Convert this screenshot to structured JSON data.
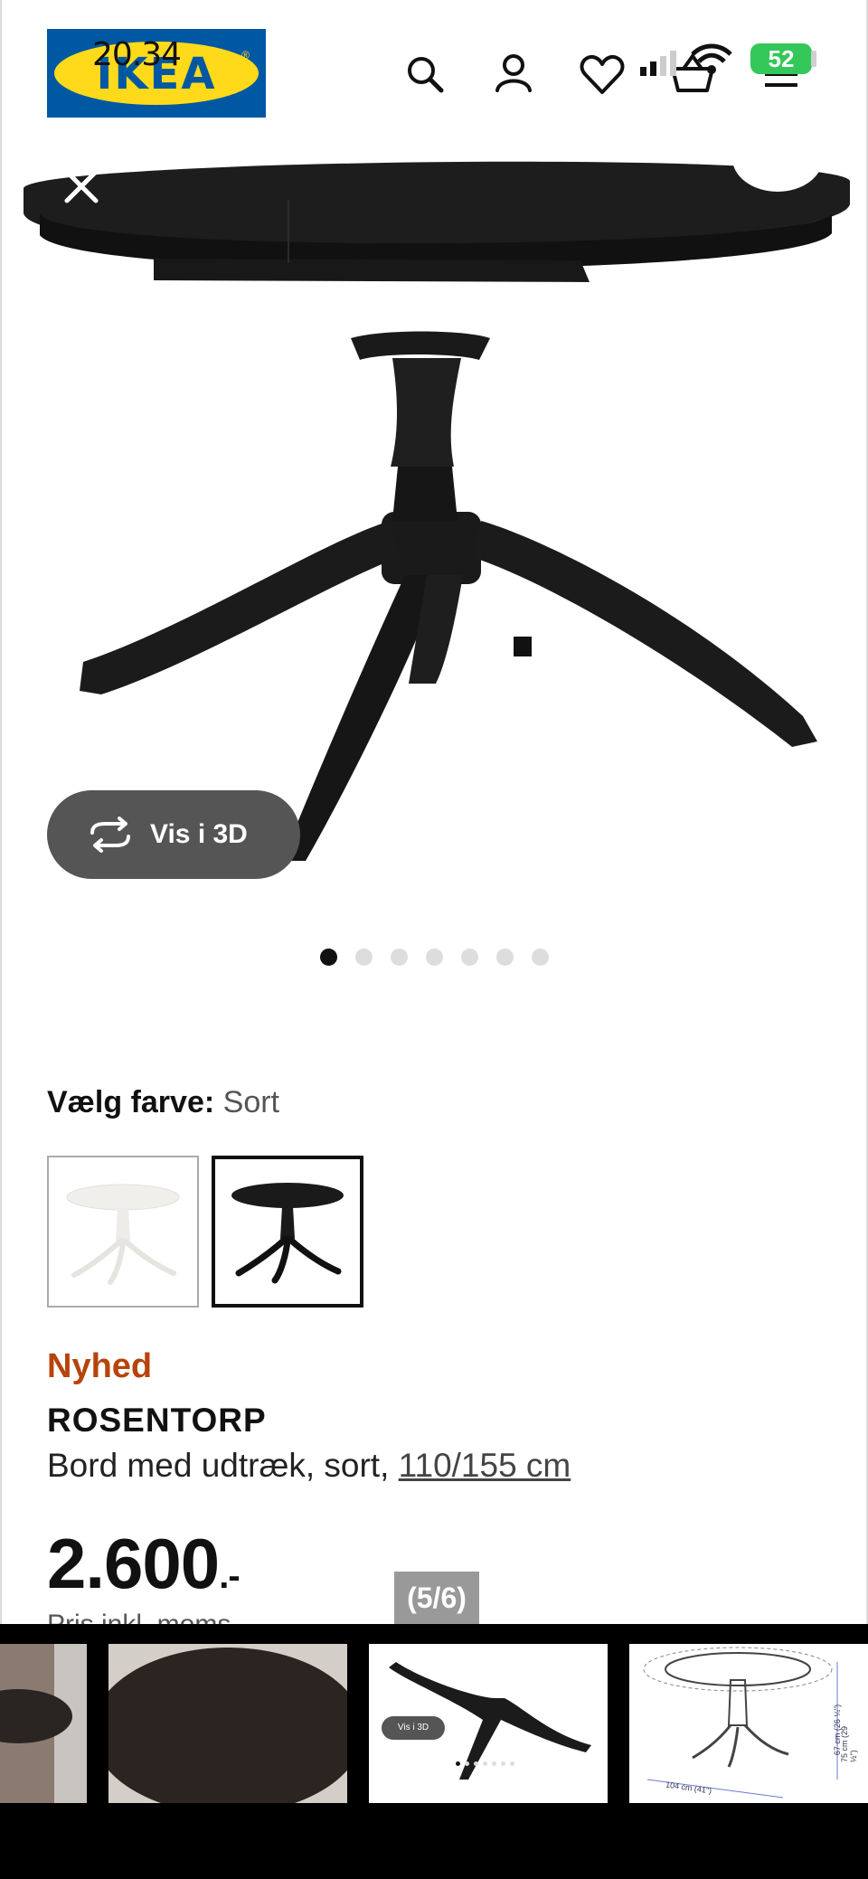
{
  "status_bar": {
    "time": "20.34",
    "battery": "52"
  },
  "header": {
    "logo_text": "IKEA",
    "logo_registered": "®"
  },
  "gallery": {
    "vis3d_label": "Vis i 3D",
    "dot_count": 7,
    "active_dot": 0,
    "counter": "(5/6)"
  },
  "color_picker": {
    "label": "Vælg farve:",
    "value": "Sort"
  },
  "product": {
    "badge": "Nyhed",
    "name": "ROSENTORP",
    "description": "Bord med udtræk, sort, ",
    "size": "110/155 cm",
    "price": "2.600",
    "price_suffix": ".-",
    "price_note": "Pris inkl. moms"
  },
  "thumbnails": {
    "t3_vis3d": "Vis i 3D",
    "t4_width": "104 cm (41\")",
    "t4_height1": "67 cm (26 ¼\")",
    "t4_height2": "75 cm (29 ½\")"
  },
  "colors": {
    "brand_blue": "#0058a3",
    "brand_yellow": "#ffda1a",
    "badge_orange": "#b6440c",
    "battery_green": "#34c759"
  }
}
